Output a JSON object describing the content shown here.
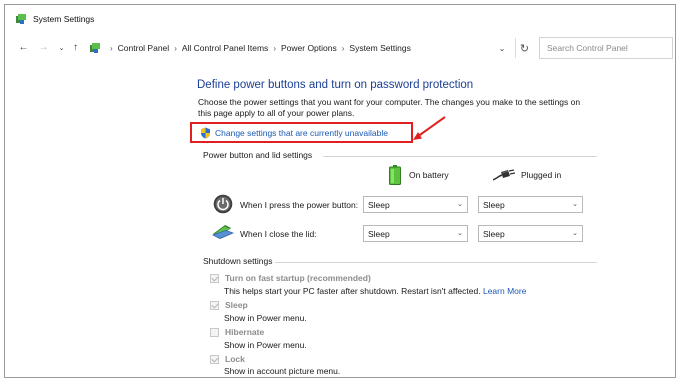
{
  "window": {
    "title": "System Settings"
  },
  "address": {
    "breadcrumbs": [
      "Control Panel",
      "All Control Panel Items",
      "Power Options",
      "System Settings"
    ],
    "search_placeholder": "Search Control Panel"
  },
  "page": {
    "heading": "Define power buttons and turn on password protection",
    "intro": "Choose the power settings that you want for your computer. The changes you make to the settings on this page apply to all of your power plans.",
    "change_link": "Change settings that are currently unavailable"
  },
  "power_section": {
    "title": "Power button and lid settings",
    "columns": [
      "On battery",
      "Plugged in"
    ],
    "rows": [
      {
        "label": "When I press the power button:",
        "on_battery": "Sleep",
        "plugged_in": "Sleep"
      },
      {
        "label": "When I close the lid:",
        "on_battery": "Sleep",
        "plugged_in": "Sleep"
      }
    ]
  },
  "shutdown_section": {
    "title": "Shutdown settings",
    "items": [
      {
        "label": "Turn on fast startup (recommended)",
        "desc": "This helps start your PC faster after shutdown. Restart isn't affected.",
        "link": "Learn More",
        "checked": true
      },
      {
        "label": "Sleep",
        "desc": "Show in Power menu.",
        "checked": true
      },
      {
        "label": "Hibernate",
        "desc": "Show in Power menu.",
        "checked": false
      },
      {
        "label": "Lock",
        "desc": "Show in account picture menu.",
        "checked": true
      }
    ]
  },
  "colors": {
    "heading": "#1b3f95",
    "link": "#1a58b5",
    "highlight": "#e02020"
  },
  "icons": [
    "app-icon",
    "back-icon",
    "forward-icon",
    "recent-dropdown-icon",
    "up-icon",
    "control-panel-icon",
    "address-dropdown-icon",
    "refresh-icon",
    "shield-icon",
    "battery-icon",
    "plug-icon",
    "power-button-icon",
    "laptop-lid-icon"
  ]
}
